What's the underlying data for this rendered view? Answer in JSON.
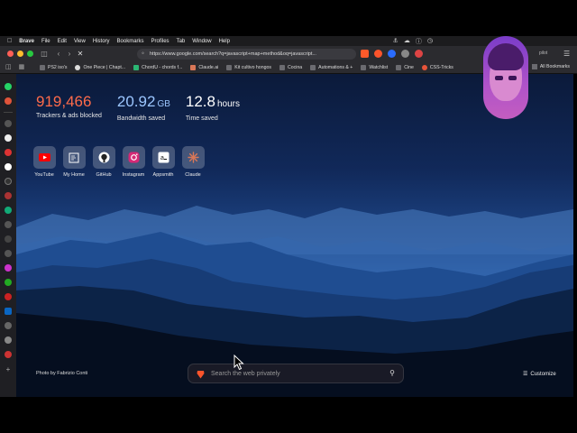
{
  "menubar": {
    "app": "Brave",
    "items": [
      "File",
      "Edit",
      "View",
      "History",
      "Bookmarks",
      "Profiles",
      "Tab",
      "Window",
      "Help"
    ]
  },
  "browser": {
    "url": "https://www.google.com/search?q=javascript+map+method&oq=javascript...",
    "copilot_badge": "pilot"
  },
  "bookmarks": {
    "items": [
      "PS2 iso's",
      "One Piece | Chapt...",
      "ChordU - chords f...",
      "Claude.ai",
      "Kit cultivo hongos",
      "Cocina",
      "Automations & +",
      "Watchlist",
      "Cine",
      "CSS-Tricks"
    ],
    "all": "All Bookmarks"
  },
  "stats": {
    "trackers": {
      "value": "919,466",
      "label": "Trackers & ads blocked"
    },
    "bandwidth": {
      "value": "20.92",
      "unit": "GB",
      "label": "Bandwidth saved"
    },
    "time": {
      "value": "12.8",
      "unit": "hours",
      "label": "Time saved"
    }
  },
  "tiles": [
    "YouTube",
    "My Home",
    "GitHub",
    "Instagram",
    "Appsmith",
    "Claude"
  ],
  "footer": {
    "photo_credit": "Photo by Fabrizio Conti",
    "search_placeholder": "Search the web privately",
    "customize": "Customize"
  },
  "colors": {
    "trackers": "#ff6b4a",
    "bandwidth": "#9bc6ff",
    "background_top": "#0b1a3a",
    "background_horizon": "#2a5ea8"
  }
}
